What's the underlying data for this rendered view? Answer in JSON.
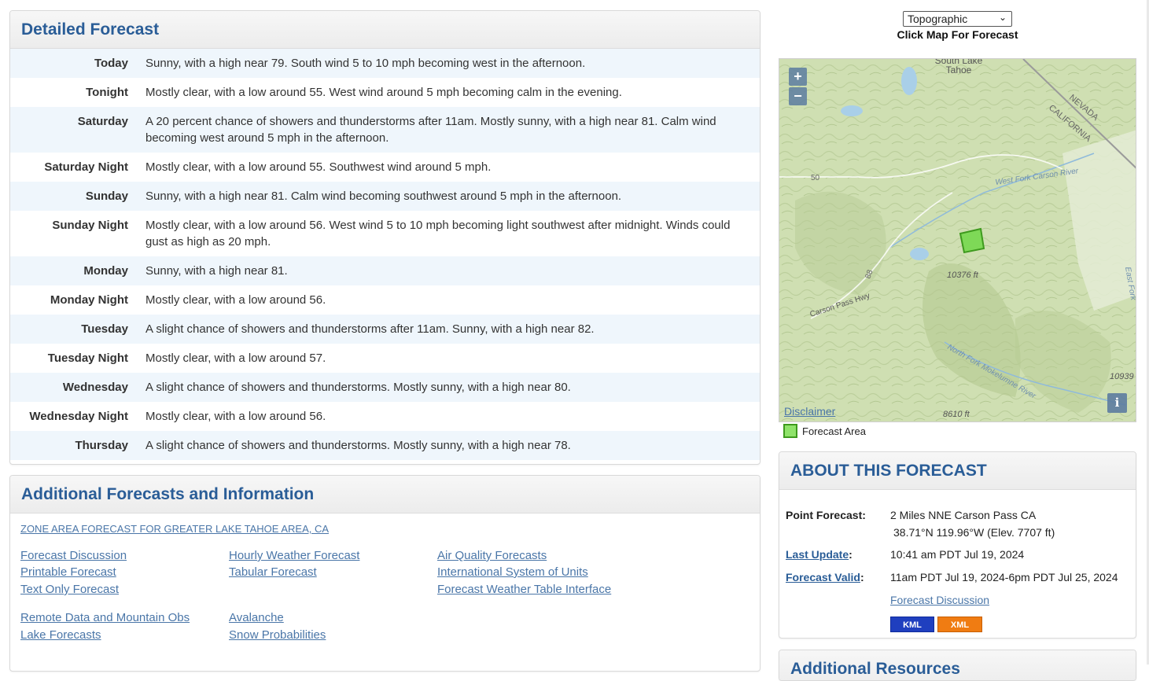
{
  "detailed": {
    "title": "Detailed Forecast",
    "periods": [
      {
        "name": "Today",
        "text": "Sunny, with a high near 79. South wind 5 to 10 mph becoming west in the afternoon."
      },
      {
        "name": "Tonight",
        "text": "Mostly clear, with a low around 55. West wind around 5 mph becoming calm in the evening."
      },
      {
        "name": "Saturday",
        "text": "A 20 percent chance of showers and thunderstorms after 11am. Mostly sunny, with a high near 81. Calm wind becoming west around 5 mph in the afternoon."
      },
      {
        "name": "Saturday Night",
        "text": "Mostly clear, with a low around 55. Southwest wind around 5 mph."
      },
      {
        "name": "Sunday",
        "text": "Sunny, with a high near 81. Calm wind becoming southwest around 5 mph in the afternoon."
      },
      {
        "name": "Sunday Night",
        "text": "Mostly clear, with a low around 56. West wind 5 to 10 mph becoming light southwest after midnight. Winds could gust as high as 20 mph."
      },
      {
        "name": "Monday",
        "text": "Sunny, with a high near 81."
      },
      {
        "name": "Monday Night",
        "text": "Mostly clear, with a low around 56."
      },
      {
        "name": "Tuesday",
        "text": "A slight chance of showers and thunderstorms after 11am. Sunny, with a high near 82."
      },
      {
        "name": "Tuesday Night",
        "text": "Mostly clear, with a low around 57."
      },
      {
        "name": "Wednesday",
        "text": "A slight chance of showers and thunderstorms. Mostly sunny, with a high near 80."
      },
      {
        "name": "Wednesday Night",
        "text": "Mostly clear, with a low around 56."
      },
      {
        "name": "Thursday",
        "text": "A slight chance of showers and thunderstorms. Mostly sunny, with a high near 78."
      }
    ]
  },
  "additional": {
    "title": "Additional Forecasts and Information",
    "zone_link": "ZONE AREA FORECAST FOR GREATER LAKE TAHOE AREA, CA",
    "col1": [
      "Forecast Discussion",
      "Printable Forecast",
      "Text Only Forecast"
    ],
    "col2": [
      "Hourly Weather Forecast",
      "Tabular Forecast"
    ],
    "col3": [
      "Air Quality Forecasts",
      "International System of Units",
      "Forecast Weather Table Interface"
    ],
    "col1b": [
      "Remote Data and Mountain Obs",
      "Lake Forecasts"
    ],
    "col2b": [
      "Avalanche",
      "Snow Probabilities"
    ]
  },
  "map": {
    "select_value": "Topographic",
    "click_label": "Click Map For Forecast",
    "zoom_in": "+",
    "zoom_out": "−",
    "disclaimer": "Disclaimer",
    "info": "i",
    "legend_label": "Forecast Area",
    "labels": {
      "south_lake": "South Lake",
      "tahoe": "Tahoe",
      "nevada": "NEVADA",
      "california": "CALIFORNIA",
      "west_fork": "West Fork Carson River",
      "elev1": "10376 ft",
      "carson_pass": "Carson Pass Hwy",
      "north_fork": "North Fork Mokelumne River",
      "elev2": "8610 ft",
      "elev3": "10939",
      "hwy50": "50",
      "hwy88": "88",
      "east_fork": "East Fork"
    },
    "colors": {
      "terrain": "#cfdfb2",
      "forecast_area": "#7ed957",
      "forecast_border": "#3e9a1e",
      "water": "#a9cfe8"
    }
  },
  "about": {
    "title": "ABOUT THIS FORECAST",
    "point_label": "Point Forecast:",
    "point_value": "2 Miles NNE Carson Pass CA",
    "point_coords": "38.71°N 119.96°W (Elev. 7707 ft)",
    "last_update_label": "Last Update",
    "last_update_value": "10:41 am PDT Jul 19, 2024",
    "valid_label": "Forecast Valid",
    "valid_value": "11am PDT Jul 19, 2024-6pm PDT Jul 25, 2024",
    "discussion_link": "Forecast Discussion",
    "kml": "KML",
    "xml": "XML",
    "colon": ":"
  },
  "extra_panel_title": "Additional Resources"
}
